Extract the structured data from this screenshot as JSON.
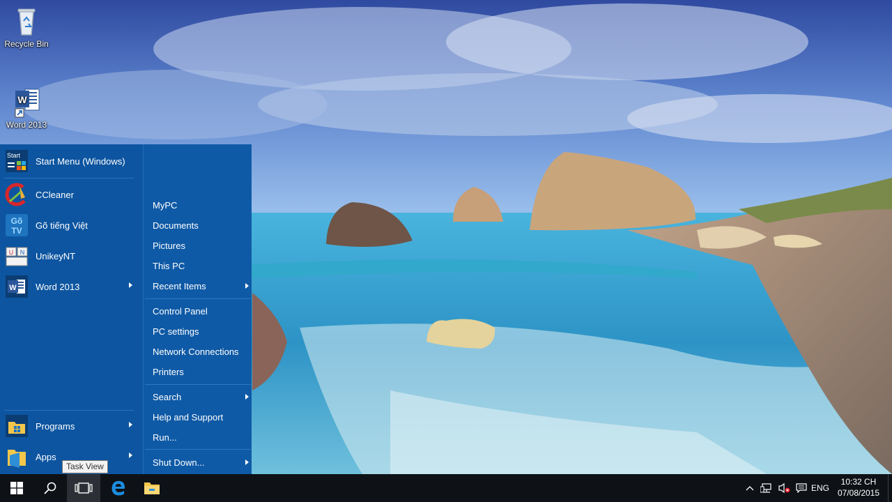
{
  "desktop": {
    "icons": [
      {
        "label": "Recycle Bin",
        "icon": "recycle-bin-icon"
      },
      {
        "label": "Word 2013",
        "icon": "word-icon"
      }
    ]
  },
  "start_menu": {
    "apps": [
      {
        "label": "Start Menu (Windows)",
        "icon": "start-menu-app-icon",
        "has_arrow": false
      },
      {
        "label": "CCleaner",
        "icon": "ccleaner-icon",
        "has_arrow": false
      },
      {
        "label": "Gõ tiếng Việt",
        "icon": "gotv-icon",
        "has_arrow": false
      },
      {
        "label": "UnikeyNT",
        "icon": "unikey-icon",
        "has_arrow": false
      },
      {
        "label": "Word 2013",
        "icon": "word-icon",
        "has_arrow": true
      }
    ],
    "bottom": [
      {
        "label": "Programs",
        "icon": "programs-folder-icon",
        "has_arrow": true
      },
      {
        "label": "Apps",
        "icon": "apps-icon",
        "has_arrow": true
      }
    ],
    "user": {
      "icon": "user-avatar-icon"
    },
    "right_groups": [
      [
        {
          "label": "MyPC",
          "has_arrow": false
        },
        {
          "label": "Documents",
          "has_arrow": false
        },
        {
          "label": "Pictures",
          "has_arrow": false
        },
        {
          "label": "This PC",
          "has_arrow": false
        },
        {
          "label": "Recent Items",
          "has_arrow": true
        }
      ],
      [
        {
          "label": "Control Panel",
          "has_arrow": false
        },
        {
          "label": "PC settings",
          "has_arrow": false
        },
        {
          "label": "Network Connections",
          "has_arrow": false
        },
        {
          "label": "Printers",
          "has_arrow": false
        }
      ],
      [
        {
          "label": "Search",
          "has_arrow": true
        },
        {
          "label": "Help and Support",
          "has_arrow": false
        },
        {
          "label": "Run...",
          "has_arrow": false
        }
      ],
      [
        {
          "label": "Shut Down...",
          "has_arrow": true
        }
      ]
    ]
  },
  "tooltip": {
    "text": "Task View"
  },
  "taskbar": {
    "buttons": [
      {
        "name": "start",
        "icon": "windows-logo-icon",
        "active": false
      },
      {
        "name": "search",
        "icon": "search-icon",
        "active": false
      },
      {
        "name": "task-view",
        "icon": "task-view-icon",
        "active": true
      },
      {
        "name": "edge",
        "icon": "edge-icon",
        "active": false
      },
      {
        "name": "file-explorer",
        "icon": "folder-icon",
        "active": false
      }
    ],
    "tray": {
      "icons": [
        "chevron-up-icon",
        "network-icon",
        "speaker-muted-icon",
        "action-center-icon"
      ],
      "language": "ENG",
      "time": "10:32 CH",
      "date": "07/08/2015"
    }
  },
  "colors": {
    "start_menu_bg": "#0f5aa6",
    "taskbar_bg": "#0e1216",
    "accent": "#0078d7"
  }
}
